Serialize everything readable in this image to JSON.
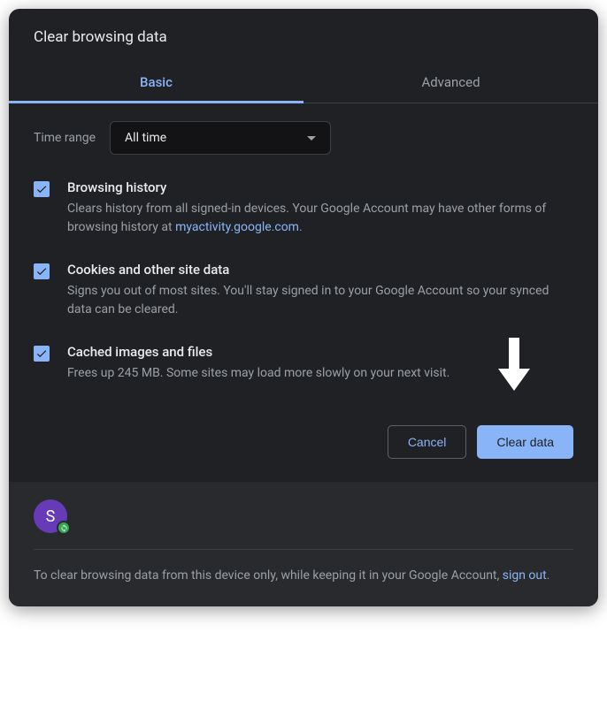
{
  "dialog": {
    "title": "Clear browsing data"
  },
  "tabs": {
    "basic": "Basic",
    "advanced": "Advanced"
  },
  "timeRange": {
    "label": "Time range",
    "selected": "All time"
  },
  "options": {
    "history": {
      "title": "Browsing history",
      "desc_prefix": "Clears history from all signed-in devices. Your Google Account may have other forms of browsing history at ",
      "link": "myactivity.google.com",
      "desc_suffix": ".",
      "checked": true
    },
    "cookies": {
      "title": "Cookies and other site data",
      "desc": "Signs you out of most sites. You'll stay signed in to your Google Account so your synced data can be cleared.",
      "checked": true
    },
    "cache": {
      "title": "Cached images and files",
      "desc": "Frees up 245 MB. Some sites may load more slowly on your next visit.",
      "checked": true
    }
  },
  "buttons": {
    "cancel": "Cancel",
    "clear": "Clear data"
  },
  "footer": {
    "avatar_initial": "S",
    "text_prefix": "To clear browsing data from this device only, while keeping it in your Google Account, ",
    "link": "sign out",
    "text_suffix": "."
  }
}
